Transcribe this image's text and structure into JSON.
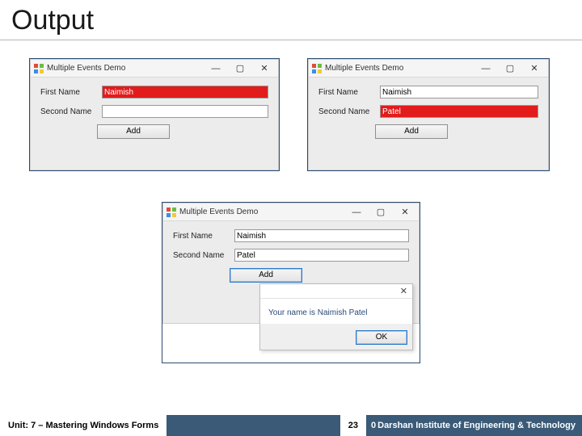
{
  "slide": {
    "title": "Output"
  },
  "window_common": {
    "title": "Multiple Events Demo",
    "icon_name": "winforms-app-icon",
    "min": "—",
    "max": "▢",
    "close": "✕"
  },
  "form_labels": {
    "first": "First Name",
    "second": "Second Name",
    "add": "Add"
  },
  "shot1": {
    "first_value": "Naimish",
    "second_value": "",
    "focus": "first"
  },
  "shot2": {
    "first_value": "Naimish",
    "second_value": "Patel",
    "focus": "second"
  },
  "shot3": {
    "first_value": "Naimish",
    "second_value": "Patel",
    "focus": "none"
  },
  "msgbox": {
    "close": "✕",
    "text": "Your name is Naimish Patel",
    "ok": "OK"
  },
  "footer": {
    "unit": "Unit: 7 – Mastering Windows Forms",
    "page": "23",
    "org": "Darshan Institute of Engineering & Technology",
    "zero": "0"
  }
}
